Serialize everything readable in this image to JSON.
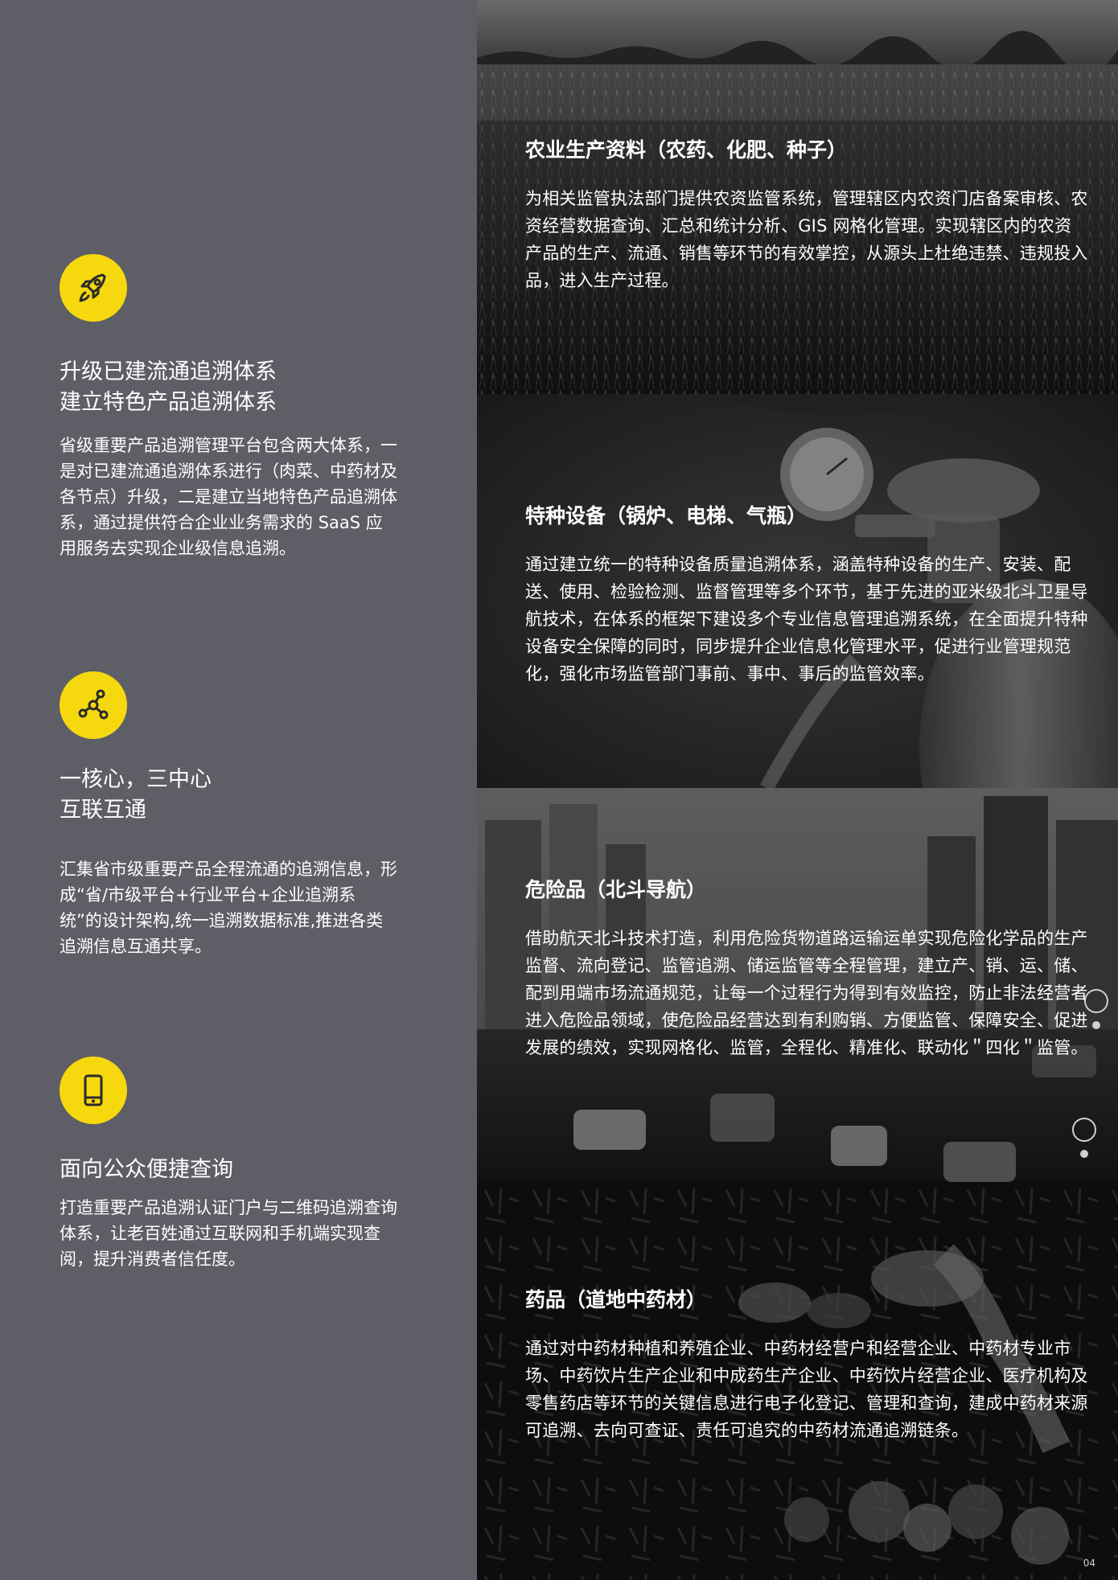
{
  "features": [
    {
      "icon": "rocket-icon",
      "title_line1": "升级已建流通追溯体系",
      "title_line2": "建立特色产品追溯体系",
      "body": "省级重要产品追溯管理平台包含两大体系，一是对已建流通追溯体系进行（肉菜、中药材及各节点）升级，二是建立当地特色产品追溯体系，通过提供符合企业业务需求的 SaaS 应用服务去实现企业级信息追溯。"
    },
    {
      "icon": "network-nodes-icon",
      "title_line1": "一核心，三中心",
      "title_line2": "互联互通",
      "body": "汇集省市级重要产品全程流通的追溯信息，形成“省/市级平台+行业平台+企业追溯系统”的设计架构,统一追溯数据标准,推进各类追溯信息互通共享。"
    },
    {
      "icon": "mobile-phone-icon",
      "title_line1": "面向公众便捷查询",
      "body": "打造重要产品追溯认证门户与二维码追溯查询体系，让老百姓通过互联网和手机端实现查阅，提升消费者信任度。"
    }
  ],
  "panels": [
    {
      "title": "农业生产资料（农药、化肥、种子）",
      "body": "为相关监管执法部门提供农资监管系统，管理辖区内农资门店备案审核、农资经营数据查询、汇总和统计分析、GIS 网格化管理。实现辖区内的农资产品的生产、流通、销售等环节的有效掌控，从源头上杜绝违禁、违规投入品，进入生产过程。"
    },
    {
      "title": "特种设备（锅炉、电梯、气瓶）",
      "body": "通过建立统一的特种设备质量追溯体系，涵盖特种设备的生产、安装、配送、使用、检验检测、监督管理等多个环节，基于先进的亚米级北斗卫星导航技术，在体系的框架下建设多个专业信息管理追溯系统，在全面提升特种设备安全保障的同时，同步提升企业信息化管理水平，促进行业管理规范化，强化市场监管部门事前、事中、事后的监管效率。"
    },
    {
      "title": "危险品（北斗导航）",
      "body": "借助航天北斗技术打造，利用危险货物道路运输运单实现危险化学品的生产监督、流向登记、监管追溯、储运监管等全程管理，建立产、销、运、储、配到用端市场流通规范，让每一个过程行为得到有效监控，防止非法经营者进入危险品领域，使危险品经营达到有利购销、方便监管、保障安全、促进发展的绩效，实现网格化、监管，全程化、精准化、联动化＂四化＂监管。"
    },
    {
      "title": "药品（道地中药材）",
      "body": "通过对中药材种植和养殖企业、中药材经营户和经营企业、中药材专业市场、中药饮片生产企业和中成药生产企业、中药饮片经营企业、医疗机构及零售药店等环节的关键信息进行电子化登记、管理和查询，建成中药材来源可追溯、去向可查证、责任可追究的中药材流通追溯链条。"
    }
  ],
  "page_number": "04",
  "colors": {
    "left_bg": "#5e5e67",
    "icon_yellow": "#f5d90e"
  }
}
